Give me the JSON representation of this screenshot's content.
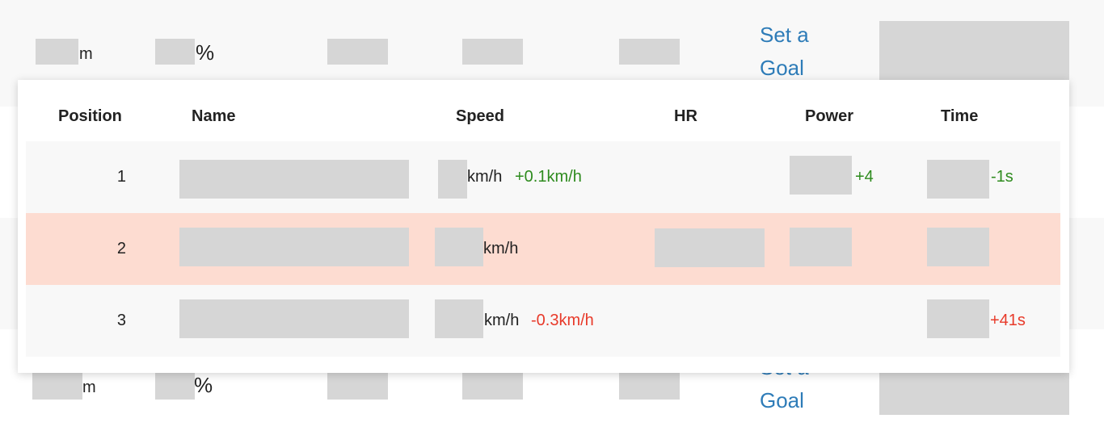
{
  "background_rows": [
    {
      "distance_unit": "m",
      "percent_unit": "%",
      "goal_link": "Set a Goal"
    },
    {
      "distance_unit": "m",
      "percent_unit": "%",
      "goal_link": "Set a Goal"
    }
  ],
  "leaderboard": {
    "headers": {
      "position": "Position",
      "name": "Name",
      "speed": "Speed",
      "hr": "HR",
      "power": "Power",
      "time": "Time"
    },
    "rows": [
      {
        "position": "1",
        "speed_unit": "km/h",
        "speed_delta": "+0.1km/h",
        "power_delta": "+4",
        "time_delta": "-1s",
        "highlighted": false
      },
      {
        "position": "2",
        "speed_unit": "km/h",
        "speed_delta": "",
        "power_delta": "",
        "time_delta": "",
        "highlighted": true
      },
      {
        "position": "3",
        "speed_unit": "km/h",
        "speed_delta": "-0.3km/h",
        "power_delta": "",
        "time_delta": "+41s",
        "highlighted": false
      }
    ]
  },
  "colors": {
    "link": "#2e7cb8",
    "positive": "#2e8b1e",
    "negative": "#e83a2a",
    "highlight_row": "#fddcd1",
    "redacted": "#d6d6d6"
  }
}
